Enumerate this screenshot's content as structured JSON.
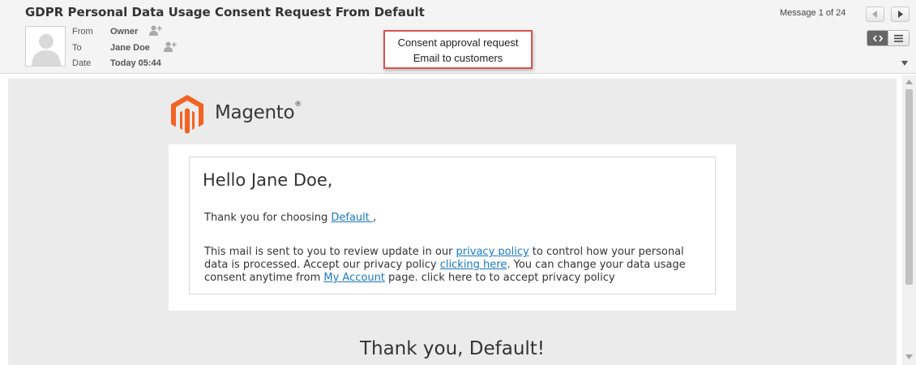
{
  "header": {
    "subject": "GDPR Personal Data Usage Consent Request From Default",
    "from_label": "From",
    "from_value": "Owner",
    "to_label": "To",
    "to_value": "Jane Doe",
    "date_label": "Date",
    "date_value": "Today 05:44",
    "counter": "Message 1 of 24"
  },
  "annotation": {
    "line1": "Consent approval request",
    "line2": "Email to customers"
  },
  "email": {
    "logo_text": "Magento",
    "logo_mark": "®",
    "greeting": "Hello Jane Doe,",
    "p1_prefix": "Thank you for choosing ",
    "p1_link": "Default ",
    "p1_suffix": ",",
    "p2_a": "This mail is sent to you to review update in our ",
    "p2_link1": "privacy policy",
    "p2_b": " to control how your personal data is processed. Accept our privacy policy ",
    "p2_link2": "clicking here",
    "p2_c": ". You can change your data usage consent anytime from ",
    "p2_link3": "My Account",
    "p2_d": " page. click here to to accept privacy policy",
    "thanks": "Thank you, Default!"
  },
  "icons": {
    "avatar": "person-placeholder-icon",
    "add_contact": "add-contact-icon",
    "prev": "arrow-left-icon",
    "next": "arrow-right-icon",
    "html_view": "code-view-icon",
    "text_view": "list-view-icon"
  },
  "colors": {
    "link": "#1979c3",
    "logo_orange": "#f26322",
    "annotation_border": "#d9534f"
  }
}
